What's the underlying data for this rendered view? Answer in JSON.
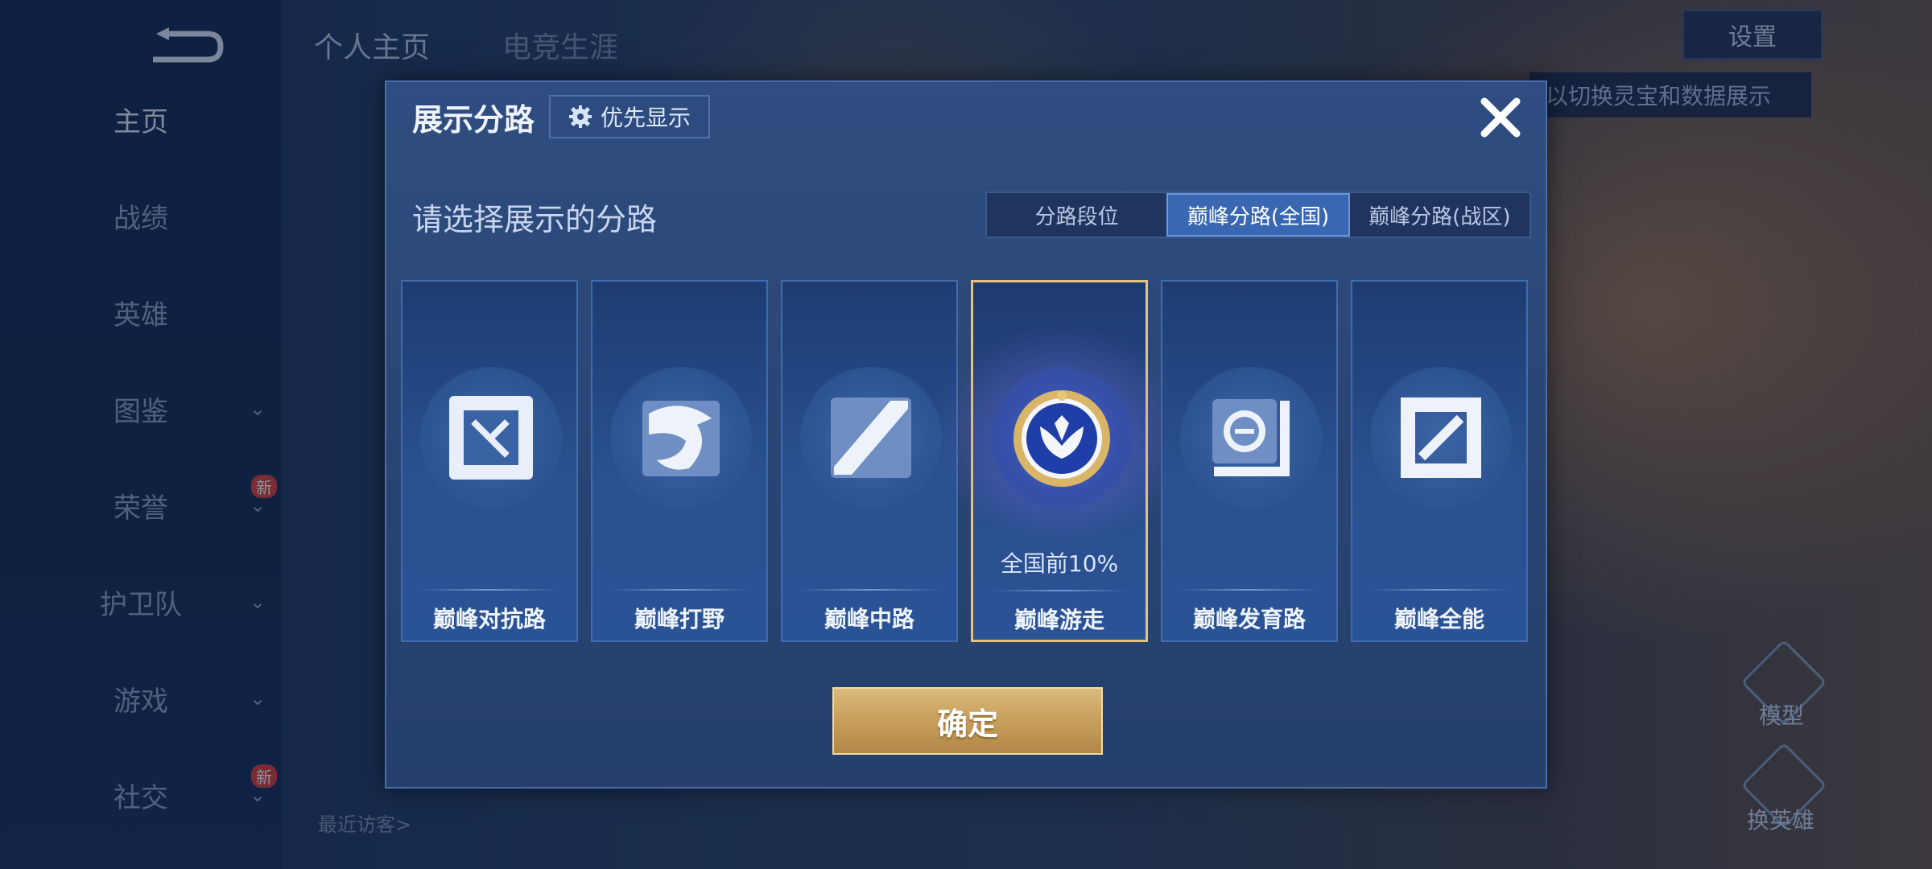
{
  "background": {
    "sidebar": {
      "items": [
        {
          "label": "主页",
          "active": true,
          "chevron": false,
          "new": false
        },
        {
          "label": "战绩",
          "active": false,
          "chevron": false,
          "new": false
        },
        {
          "label": "英雄",
          "active": false,
          "chevron": false,
          "new": false
        },
        {
          "label": "图鉴",
          "active": false,
          "chevron": true,
          "new": false
        },
        {
          "label": "荣誉",
          "active": false,
          "chevron": true,
          "new": true
        },
        {
          "label": "护卫队",
          "active": false,
          "chevron": true,
          "new": false
        },
        {
          "label": "游戏",
          "active": false,
          "chevron": true,
          "new": false
        },
        {
          "label": "社交",
          "active": false,
          "chevron": true,
          "new": true
        }
      ],
      "new_badge": "新"
    },
    "top_tabs": [
      "个人主页",
      "电竞生涯"
    ],
    "settings_label": "设置",
    "tip_text": "以切换灵宝和数据展示",
    "side_buttons": [
      "模型",
      "换英雄"
    ],
    "visitors_label": "最近访客>"
  },
  "dialog": {
    "title": "展示分路",
    "priority_button": "优先显示",
    "subtitle": "请选择展示的分路",
    "tabs": [
      {
        "label": "分路段位",
        "active": false
      },
      {
        "label": "巅峰分路(全国)",
        "active": true
      },
      {
        "label": "巅峰分路(战区)",
        "active": false
      }
    ],
    "cards": [
      {
        "label": "巅峰对抗路",
        "icon": "clash-lane-icon",
        "selected": false,
        "rank": ""
      },
      {
        "label": "巅峰打野",
        "icon": "jungle-dragon-icon",
        "selected": false,
        "rank": ""
      },
      {
        "label": "巅峰中路",
        "icon": "mid-lane-icon",
        "selected": false,
        "rank": ""
      },
      {
        "label": "巅峰游走",
        "icon": "roam-wings-emblem-icon",
        "selected": true,
        "rank": "全国前10%"
      },
      {
        "label": "巅峰发育路",
        "icon": "farm-lane-icon",
        "selected": false,
        "rank": ""
      },
      {
        "label": "巅峰全能",
        "icon": "all-round-icon",
        "selected": false,
        "rank": ""
      }
    ],
    "confirm_button": "确定"
  },
  "colors": {
    "accent_gold": "#e6c27a",
    "tab_active": "#3a67b2",
    "dialog_bg": "#2a4676"
  }
}
